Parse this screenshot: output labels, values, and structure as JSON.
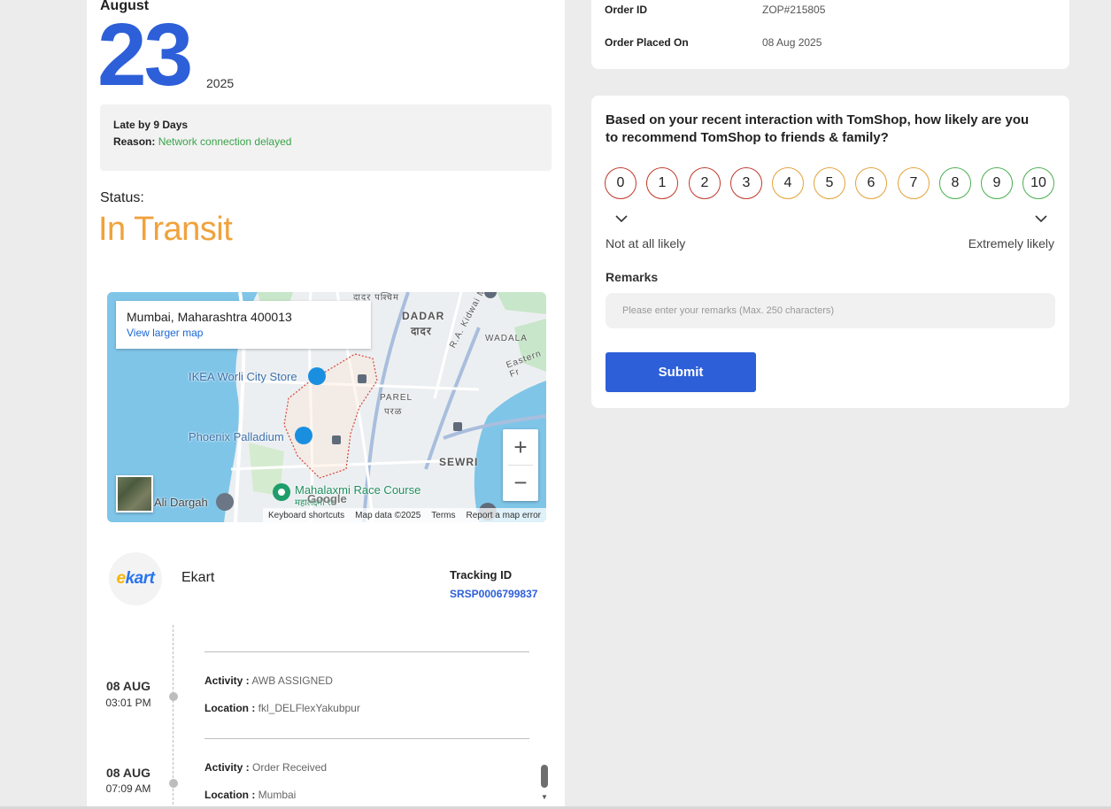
{
  "delivery": {
    "month": "August",
    "day": "23",
    "year": "2025",
    "late_text": "Late by 9 Days",
    "reason_label": "Reason:",
    "reason_value": "Network connection delayed"
  },
  "status": {
    "label": "Status:",
    "value": "In Transit"
  },
  "map": {
    "address": "Mumbai, Maharashtra 400013",
    "view_larger": "View larger map",
    "places": {
      "ikea": "IKEA Worli City Store",
      "phoenix": "Phoenix Palladium",
      "mahalaxmi": "Mahalaxmi Race Course",
      "mahalaxmi_hindi": "महालक्ष्मी रेस",
      "ali": "Ali Dargah",
      "dadar": "DADAR",
      "dadar_hindi": "दादर",
      "dadar_west": "दादर पश्चिम",
      "parel": "PAREL",
      "parel_hindi": "परळ",
      "sewri": "SEWRI",
      "wadala": "WADALA",
      "kidwai": "R.A. Kidwai Marg",
      "eastern": "Eastern Fr"
    },
    "zoom_in": "+",
    "zoom_out": "−",
    "google": "Google",
    "footer": {
      "shortcuts": "Keyboard shortcuts",
      "map_data": "Map data ©2025",
      "terms": "Terms",
      "report": "Report a map error"
    }
  },
  "carrier": {
    "logo_text_e": "e",
    "logo_text_rest": "kart",
    "name": "Ekart",
    "tracking_label": "Tracking ID",
    "tracking_id": "SRSP0006799837"
  },
  "timeline": [
    {
      "date": "08 AUG",
      "time": "03:01 PM",
      "activity_label": "Activity :",
      "activity": "AWB ASSIGNED",
      "location_label": "Location :",
      "location": "fkl_DELFlexYakubpur"
    },
    {
      "date": "08 AUG",
      "time": "07:09 AM",
      "activity_label": "Activity :",
      "activity": "Order Received",
      "location_label": "Location :",
      "location": "Mumbai"
    }
  ],
  "order": {
    "id_label": "Order ID",
    "id_value": "ZOP#215805",
    "placed_label": "Order Placed On",
    "placed_value": "08 Aug 2025"
  },
  "nps": {
    "question": "Based on your recent interaction with TomShop, how likely are you to recommend TomShop to friends & family?",
    "scores": [
      "0",
      "1",
      "2",
      "3",
      "4",
      "5",
      "6",
      "7",
      "8",
      "9",
      "10"
    ],
    "low_label": "Not at all likely",
    "high_label": "Extremely likely",
    "remarks_label": "Remarks",
    "remarks_placeholder": "Please enter your remarks (Max. 250 characters)",
    "submit_label": "Submit"
  },
  "colors": {
    "accent_blue": "#2d5fd8",
    "status_orange": "#f0a23c",
    "reason_green": "#3aa34a",
    "nps_red": "#c0392b",
    "nps_orange": "#e3a23a",
    "nps_green": "#4caf50"
  },
  "icons": {
    "chevron": "chevron-down-icon",
    "map_pin": "shopping-pin-icon",
    "transit": "transit-station-icon"
  }
}
